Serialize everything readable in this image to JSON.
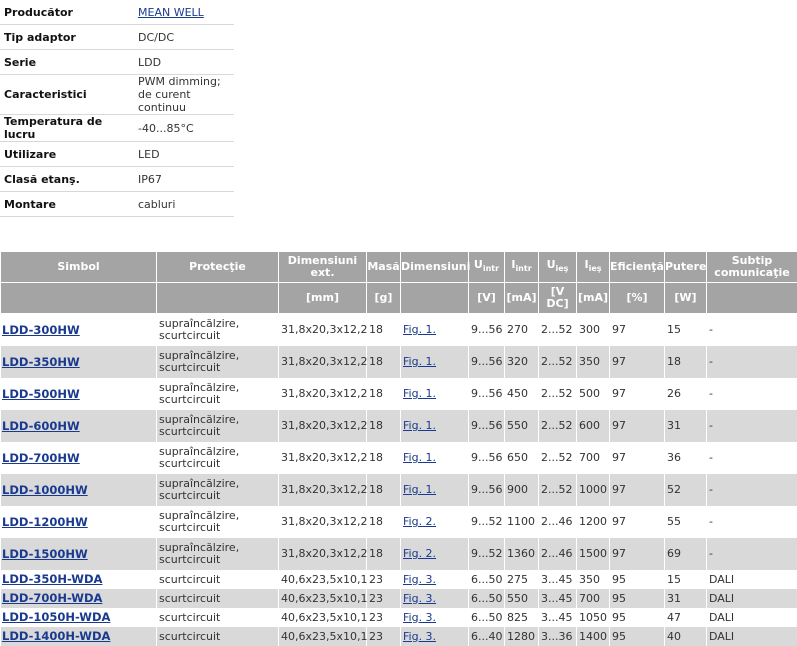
{
  "properties": [
    {
      "label": "Producător",
      "value": "MEAN WELL",
      "link": true
    },
    {
      "label": "Tip adaptor",
      "value": "DC/DC"
    },
    {
      "label": "Serie",
      "value": "LDD"
    },
    {
      "label": "Caracteristici",
      "value": "PWM dimming;",
      "value2": "de curent continuu"
    },
    {
      "label": "Temperatura de lucru",
      "value": "-40...85°C"
    },
    {
      "label": "Utilizare",
      "value": "LED"
    },
    {
      "label": "Clasă etanş.",
      "value": "IP67"
    },
    {
      "label": "Montare",
      "value": "cabluri"
    }
  ],
  "table": {
    "headers": {
      "simbol": "Simbol",
      "protectie": "Protecţie",
      "dim_ext": "Dimensiuni ext.",
      "masa": "Masă",
      "dimensiuni": "Dimensiuni",
      "u_intr": "U",
      "u_intr_sub": "intr",
      "i_intr": "I",
      "i_intr_sub": "intr",
      "u_ies": "U",
      "u_ies_sub": "ieş",
      "i_ies": "I",
      "i_ies_sub": "ieş",
      "eficienta": "Eficienţă",
      "putere": "Putere",
      "subtip": "Subtip comunicaţie"
    },
    "units": {
      "dim_ext": "[mm]",
      "masa": "[g]",
      "u_intr": "[V]",
      "i_intr": "[mA]",
      "u_ies": "[V DC]",
      "i_ies": "[mA]",
      "eficienta": "[%]",
      "putere": "[W]"
    },
    "rows": [
      {
        "simbol": "LDD-300HW",
        "protectie": "supraîncălzire,",
        "protectie2": "scurtcircuit",
        "dim": "31,8x20,3x12,2",
        "masa": "18",
        "fig": "Fig. 1.",
        "u_intr": "9...56",
        "i_intr": "270",
        "u_ies": "2...52",
        "i_ies": "300",
        "eff": "97",
        "putere": "15",
        "subtip": "-"
      },
      {
        "simbol": "LDD-350HW",
        "protectie": "supraîncălzire,",
        "protectie2": "scurtcircuit",
        "dim": "31,8x20,3x12,2",
        "masa": "18",
        "fig": "Fig. 1.",
        "u_intr": "9...56",
        "i_intr": "320",
        "u_ies": "2...52",
        "i_ies": "350",
        "eff": "97",
        "putere": "18",
        "subtip": "-"
      },
      {
        "simbol": "LDD-500HW",
        "protectie": "supraîncălzire,",
        "protectie2": "scurtcircuit",
        "dim": "31,8x20,3x12,2",
        "masa": "18",
        "fig": "Fig. 1.",
        "u_intr": "9...56",
        "i_intr": "450",
        "u_ies": "2...52",
        "i_ies": "500",
        "eff": "97",
        "putere": "26",
        "subtip": "-"
      },
      {
        "simbol": "LDD-600HW",
        "protectie": "supraîncălzire,",
        "protectie2": "scurtcircuit",
        "dim": "31,8x20,3x12,2",
        "masa": "18",
        "fig": "Fig. 1.",
        "u_intr": "9...56",
        "i_intr": "550",
        "u_ies": "2...52",
        "i_ies": "600",
        "eff": "97",
        "putere": "31",
        "subtip": "-"
      },
      {
        "simbol": "LDD-700HW",
        "protectie": "supraîncălzire,",
        "protectie2": "scurtcircuit",
        "dim": "31,8x20,3x12,2",
        "masa": "18",
        "fig": "Fig. 1.",
        "u_intr": "9...56",
        "i_intr": "650",
        "u_ies": "2...52",
        "i_ies": "700",
        "eff": "97",
        "putere": "36",
        "subtip": "-"
      },
      {
        "simbol": "LDD-1000HW",
        "protectie": "supraîncălzire,",
        "protectie2": "scurtcircuit",
        "dim": "31,8x20,3x12,2",
        "masa": "18",
        "fig": "Fig. 1.",
        "u_intr": "9...56",
        "i_intr": "900",
        "u_ies": "2...52",
        "i_ies": "1000",
        "eff": "97",
        "putere": "52",
        "subtip": "-"
      },
      {
        "simbol": "LDD-1200HW",
        "protectie": "supraîncălzire,",
        "protectie2": "scurtcircuit",
        "dim": "31,8x20,3x12,2",
        "masa": "18",
        "fig": "Fig. 2.",
        "u_intr": "9...52",
        "i_intr": "1100",
        "u_ies": "2...46",
        "i_ies": "1200",
        "eff": "97",
        "putere": "55",
        "subtip": "-"
      },
      {
        "simbol": "LDD-1500HW",
        "protectie": "supraîncălzire,",
        "protectie2": "scurtcircuit",
        "dim": "31,8x20,3x12,2",
        "masa": "18",
        "fig": "Fig. 2.",
        "u_intr": "9...52",
        "i_intr": "1360",
        "u_ies": "2...46",
        "i_ies": "1500",
        "eff": "97",
        "putere": "69",
        "subtip": "-"
      },
      {
        "simbol": "LDD-350H-WDA",
        "protectie": "scurtcircuit",
        "dim": "40,6x23,5x10,1",
        "masa": "23",
        "fig": "Fig. 3.",
        "u_intr": "6...50",
        "i_intr": "275",
        "u_ies": "3...45",
        "i_ies": "350",
        "eff": "95",
        "putere": "15",
        "subtip": "DALI"
      },
      {
        "simbol": "LDD-700H-WDA",
        "protectie": "scurtcircuit",
        "dim": "40,6x23,5x10,1",
        "masa": "23",
        "fig": "Fig. 3.",
        "u_intr": "6...50",
        "i_intr": "550",
        "u_ies": "3...45",
        "i_ies": "700",
        "eff": "95",
        "putere": "31",
        "subtip": "DALI"
      },
      {
        "simbol": "LDD-1050H-WDA",
        "protectie": "scurtcircuit",
        "dim": "40,6x23,5x10,1",
        "masa": "23",
        "fig": "Fig. 3.",
        "u_intr": "6...50",
        "i_intr": "825",
        "u_ies": "3...45",
        "i_ies": "1050",
        "eff": "95",
        "putere": "47",
        "subtip": "DALI"
      },
      {
        "simbol": "LDD-1400H-WDA",
        "protectie": "scurtcircuit",
        "dim": "40,6x23,5x10,1",
        "masa": "23",
        "fig": "Fig. 3.",
        "u_intr": "6...40",
        "i_intr": "1280",
        "u_ies": "3...36",
        "i_ies": "1400",
        "eff": "95",
        "putere": "40",
        "subtip": "DALI"
      }
    ]
  }
}
